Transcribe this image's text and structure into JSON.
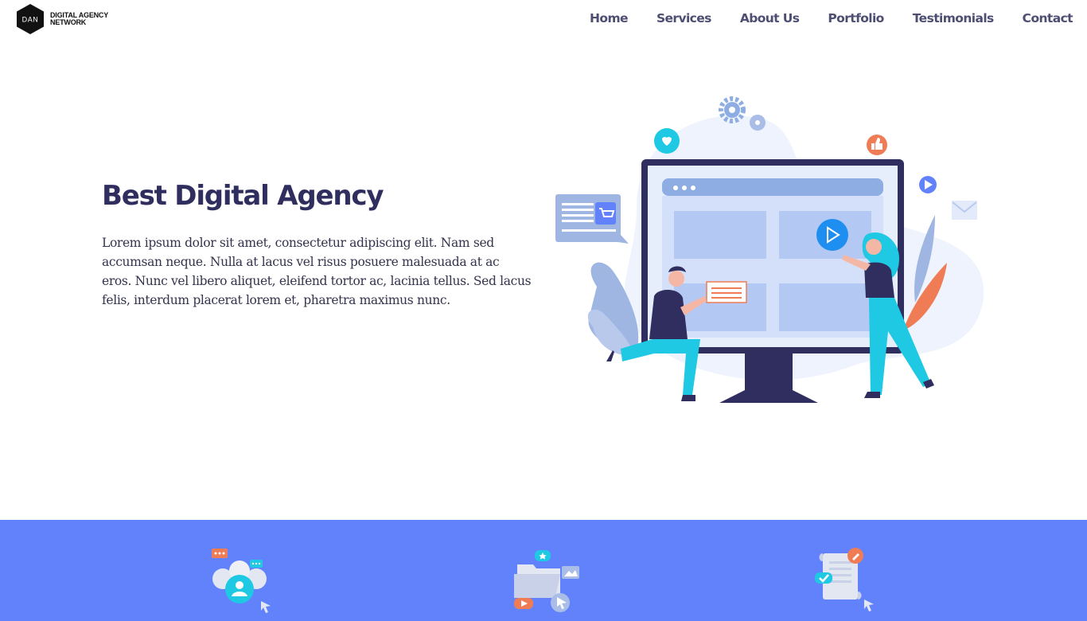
{
  "brand": {
    "logo_initials": "DAN",
    "name_line1": "DIGITAL AGENCY",
    "name_line2": "NETWORK"
  },
  "nav": {
    "items": [
      "Home",
      "Services",
      "About Us",
      "Portfolio",
      "Testimonials",
      "Contact"
    ]
  },
  "hero": {
    "title": "Best Digital Agency",
    "text": "Lorem ipsum dolor sit amet, consectetur adipiscing elit. Nam sed accumsan neque. Nulla at lacus vel risus posuere malesuada at ac eros. Nunc vel libero aliquet, eleifend tortor ac, lacinia tellus. Sed lacus felis, interdum placerat lorem et, pharetra maximus nunc.",
    "illustration": "digital-agency-illustration"
  },
  "services_band": {
    "color": "#6282fc",
    "icons": [
      "team-chat-icon",
      "media-folder-icon",
      "document-edit-icon"
    ]
  },
  "colors": {
    "heading": "#2f2e5e",
    "nav": "#4d4e72",
    "accent_blue": "#6282fc",
    "accent_cyan": "#1fc8e3",
    "accent_orange": "#f07c56"
  }
}
